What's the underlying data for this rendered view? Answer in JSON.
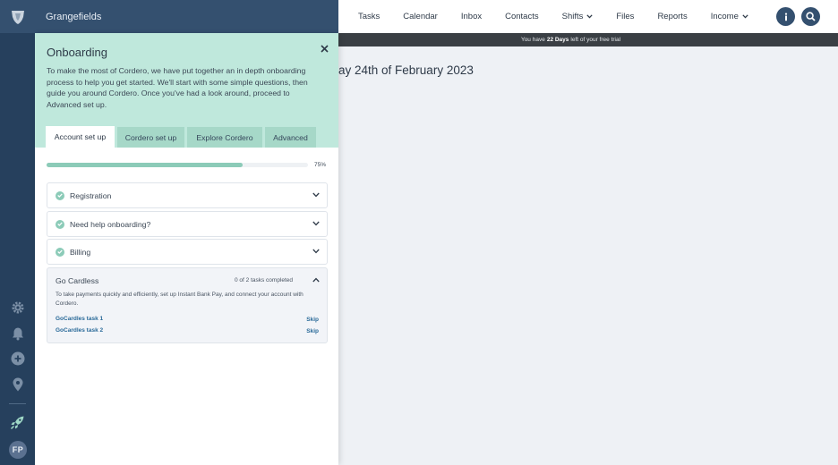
{
  "app": {
    "org_name": "Grangefields",
    "user_initials": "FP"
  },
  "nav": {
    "items": [
      {
        "label": "Tasks",
        "dropdown": false
      },
      {
        "label": "Calendar",
        "dropdown": false
      },
      {
        "label": "Inbox",
        "dropdown": false
      },
      {
        "label": "Contacts",
        "dropdown": false
      },
      {
        "label": "Shifts",
        "dropdown": true
      },
      {
        "label": "Files",
        "dropdown": false
      },
      {
        "label": "Reports",
        "dropdown": false
      },
      {
        "label": "Income",
        "dropdown": true
      }
    ],
    "info_icon": "info-icon",
    "search_icon": "search-icon"
  },
  "trial": {
    "prefix": "You have",
    "days": "22 Days",
    "suffix": "left of your free trial"
  },
  "main": {
    "heading_partial": "ay 24th of February 2023"
  },
  "rail_icons": [
    "gear-icon",
    "bell-icon",
    "plus-circle-icon",
    "location-pin-icon",
    "rocket-icon"
  ],
  "onboarding": {
    "title": "Onboarding",
    "description": "To make the most of Cordero, we have put together an in depth onboarding process to help you get started. We'll start with some simple questions, then guide you around Cordero. Once you've had a look around, proceed to Advanced set up.",
    "tabs": [
      {
        "label": "Account set up",
        "active": true
      },
      {
        "label": "Cordero set up",
        "active": false
      },
      {
        "label": "Explore Cordero",
        "active": false
      },
      {
        "label": "Advanced",
        "active": false
      }
    ],
    "progress": {
      "value": 0.75,
      "label": "75%"
    },
    "sections": [
      {
        "label": "Registration",
        "completed": true
      },
      {
        "label": "Need help onboarding?",
        "completed": true
      },
      {
        "label": "Billing",
        "completed": true
      }
    ],
    "go_cardless": {
      "title": "Go Cardless",
      "count": "0 of 2 tasks completed",
      "description": "To take payments quickly and efficiently, set up Instant Bank Pay, and connect your account with Cordero.",
      "tasks": [
        {
          "label": "GoCardles task 1",
          "action": "Skip"
        },
        {
          "label": "GoCardles task 2",
          "action": "Skip"
        }
      ]
    }
  },
  "colors": {
    "rail": "#26405d",
    "brand_bar": "#34506f",
    "panel_header": "#bfe8dc",
    "tab_inactive": "#a6d8c8",
    "accent_teal": "#8ccbb8",
    "link": "#2a6a99"
  }
}
